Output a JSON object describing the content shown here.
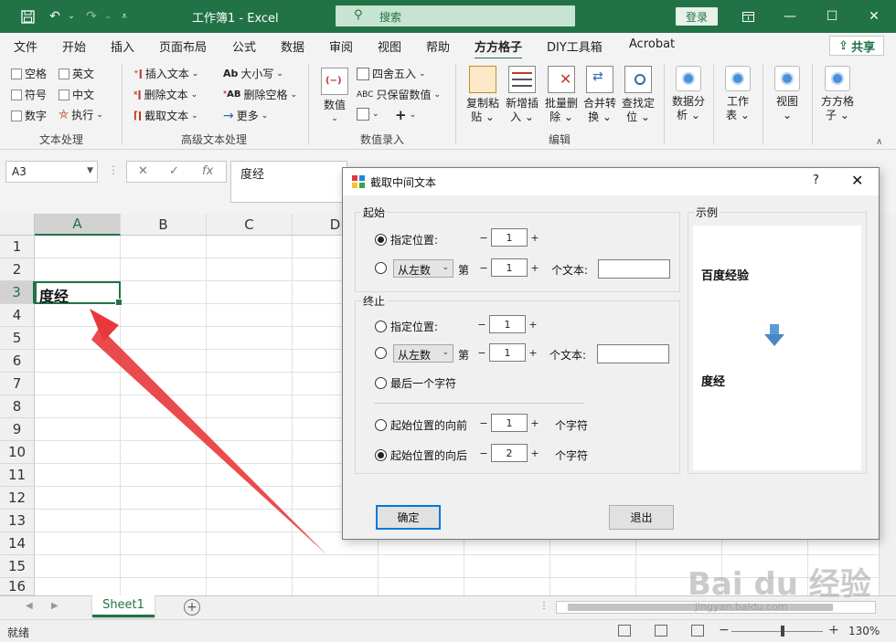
{
  "titlebar": {
    "title": "工作簿1 - Excel",
    "search_placeholder": "搜索",
    "login": "登录"
  },
  "tabs": [
    "文件",
    "开始",
    "插入",
    "页面布局",
    "公式",
    "数据",
    "审阅",
    "视图",
    "帮助",
    "方方格子",
    "DIY工具箱",
    "Acrobat"
  ],
  "active_tab": "方方格子",
  "share": "共享",
  "ribbon": {
    "text_group": {
      "label": "文本处理",
      "checks": [
        "空格",
        "英文",
        "符号",
        "中文",
        "数字"
      ],
      "execute": "执行"
    },
    "advanced_group": {
      "label": "高级文本处理",
      "insert_text": "插入文本",
      "delete_text": "删除文本",
      "extract_text": "截取文本",
      "case": "大小写",
      "delete_space": "删除空格",
      "more": "更多"
    },
    "number_group": {
      "label": "数值录入",
      "value": "数值",
      "round": "四舍五入",
      "keep_number": "只保留数值"
    },
    "edit_group": {
      "label": "编辑",
      "buttons": [
        "复制粘贴",
        "新增插入",
        "批量删除",
        "合并转换",
        "查找定位"
      ]
    },
    "extra_buttons": [
      {
        "line1": "数据分",
        "line2": "析"
      },
      {
        "line1": "工作",
        "line2": "表"
      },
      {
        "line1": "视图",
        "line2": ""
      },
      {
        "line1": "方方格",
        "line2": "子"
      }
    ]
  },
  "formula_bar": {
    "name_box": "A3",
    "content": "度经"
  },
  "grid": {
    "columns": [
      "A",
      "B",
      "C",
      "D"
    ],
    "rows": [
      "1",
      "2",
      "3",
      "4",
      "5",
      "6",
      "7",
      "8",
      "9",
      "10",
      "11",
      "12",
      "13",
      "14",
      "15",
      "16"
    ],
    "selected_cell_value": "度经"
  },
  "sheet": {
    "tab": "Sheet1",
    "status": "就绪",
    "zoom": "130%"
  },
  "dialog": {
    "title": "截取中间文本",
    "help": "?",
    "start": {
      "legend": "起始",
      "opt_position": "指定位置:",
      "position_value": "1",
      "direction": "从左数",
      "nth": "第",
      "nth_value": "1",
      "text_label": "个文本:"
    },
    "end": {
      "legend": "终止",
      "opt_position": "指定位置:",
      "position_value": "1",
      "direction": "从左数",
      "nth": "第",
      "nth_value": "1",
      "text_label": "个文本:",
      "last_char": "最后一个字符",
      "before_start": "起始位置的向前",
      "before_value": "1",
      "after_start": "起始位置的向后",
      "after_value": "2",
      "chars": "个字符"
    },
    "example": {
      "legend": "示例",
      "source": "百度经验",
      "result": "度经"
    },
    "ok": "确定",
    "cancel": "退出"
  },
  "watermark": {
    "main": "Bai du 经验",
    "sub": "jingyan.baidu.com"
  }
}
